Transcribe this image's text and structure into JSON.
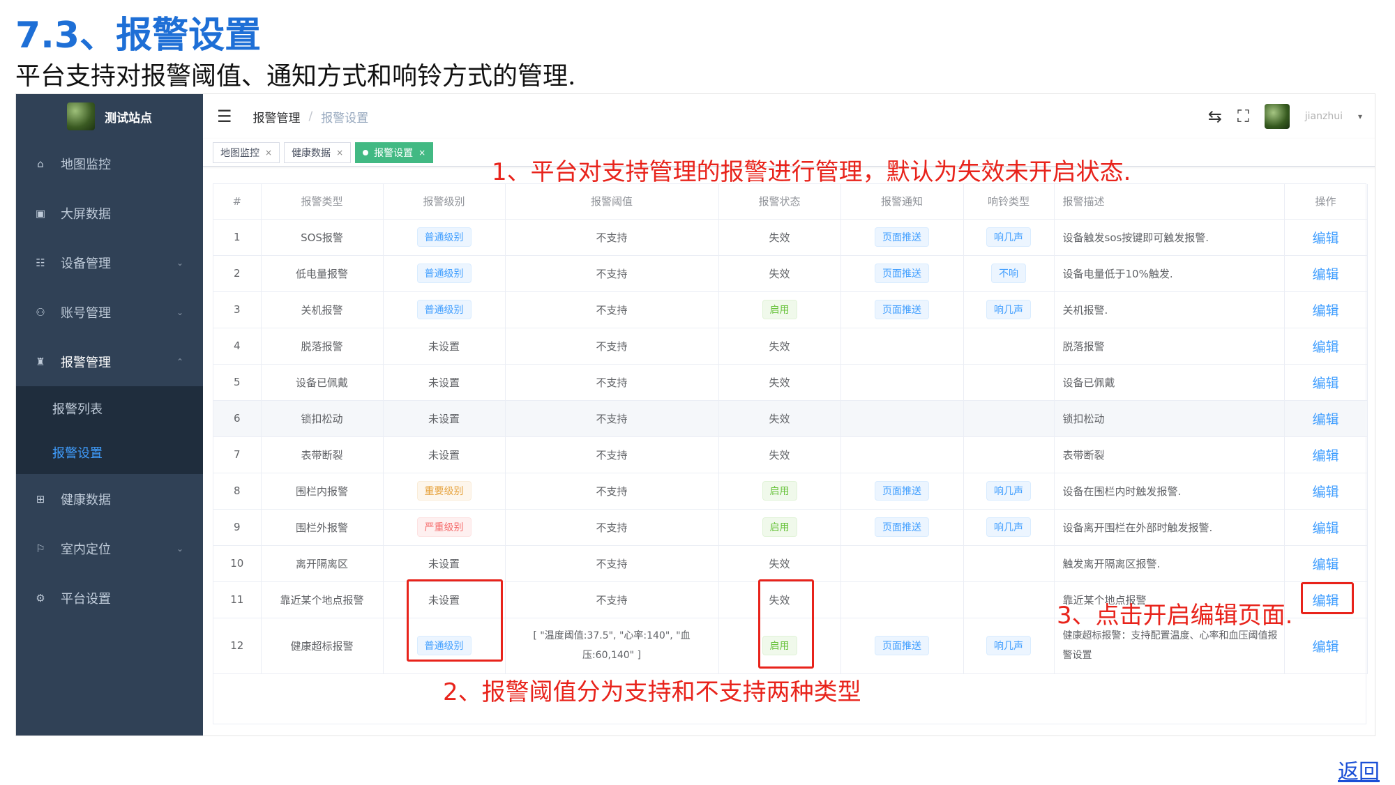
{
  "doc": {
    "title": "7.3、报警设置",
    "description": "平台支持对报警阈值、通知方式和响铃方式的管理.",
    "back_link": "返回"
  },
  "sidebar": {
    "site_name": "测试站点",
    "items": [
      {
        "label": "地图监控",
        "icon": "home-icon",
        "glyph": "⌂",
        "has_children": false
      },
      {
        "label": "大屏数据",
        "icon": "chart-icon",
        "glyph": "▣",
        "has_children": false
      },
      {
        "label": "设备管理",
        "icon": "server-icon",
        "glyph": "☷",
        "has_children": true
      },
      {
        "label": "账号管理",
        "icon": "org-icon",
        "glyph": "⚇",
        "has_children": true
      },
      {
        "label": "报警管理",
        "icon": "alarm-icon",
        "glyph": "♜",
        "has_children": true,
        "expanded": true
      },
      {
        "label": "健康数据",
        "icon": "medkit-icon",
        "glyph": "⊞",
        "has_children": false
      },
      {
        "label": "室内定位",
        "icon": "map-icon",
        "glyph": "⚐",
        "has_children": true
      },
      {
        "label": "平台设置",
        "icon": "gear-icon",
        "glyph": "⚙",
        "has_children": false
      }
    ],
    "alarm_submenu": [
      {
        "label": "报警列表",
        "active": false
      },
      {
        "label": "报警设置",
        "active": true
      }
    ]
  },
  "navbar": {
    "breadcrumb": [
      "报警管理",
      "报警设置"
    ],
    "user_name": "jianzhui"
  },
  "tags": [
    {
      "label": "地图监控",
      "active": false
    },
    {
      "label": "健康数据",
      "active": false
    },
    {
      "label": "报警设置",
      "active": true
    }
  ],
  "table": {
    "columns": [
      "#",
      "报警类型",
      "报警级别",
      "报警阈值",
      "报警状态",
      "报警通知",
      "响铃类型",
      "报警描述",
      "操作"
    ],
    "rows": [
      {
        "no": "1",
        "type": "SOS报警",
        "level": "普通级别",
        "level_style": "blue",
        "threshold": "不支持",
        "status": "失效",
        "status_style": "plain",
        "notify": "页面推送",
        "ring": "响几声",
        "desc": "设备触发sos按键即可触发报警.",
        "action": "编辑"
      },
      {
        "no": "2",
        "type": "低电量报警",
        "level": "普通级别",
        "level_style": "blue",
        "threshold": "不支持",
        "status": "失效",
        "status_style": "plain",
        "notify": "页面推送",
        "ring": "不响",
        "desc": "设备电量低于10%触发.",
        "action": "编辑"
      },
      {
        "no": "3",
        "type": "关机报警",
        "level": "普通级别",
        "level_style": "blue",
        "threshold": "不支持",
        "status": "启用",
        "status_style": "green",
        "notify": "页面推送",
        "ring": "响几声",
        "desc": "关机报警.",
        "action": "编辑"
      },
      {
        "no": "4",
        "type": "脱落报警",
        "level": "未设置",
        "level_style": "plain",
        "threshold": "不支持",
        "status": "失效",
        "status_style": "plain",
        "notify": "",
        "ring": "",
        "desc": "脱落报警",
        "action": "编辑"
      },
      {
        "no": "5",
        "type": "设备已佩戴",
        "level": "未设置",
        "level_style": "plain",
        "threshold": "不支持",
        "status": "失效",
        "status_style": "plain",
        "notify": "",
        "ring": "",
        "desc": "设备已佩戴",
        "action": "编辑"
      },
      {
        "no": "6",
        "type": "锁扣松动",
        "level": "未设置",
        "level_style": "plain",
        "threshold": "不支持",
        "status": "失效",
        "status_style": "plain",
        "notify": "",
        "ring": "",
        "desc": "锁扣松动",
        "action": "编辑"
      },
      {
        "no": "7",
        "type": "表带断裂",
        "level": "未设置",
        "level_style": "plain",
        "threshold": "不支持",
        "status": "失效",
        "status_style": "plain",
        "notify": "",
        "ring": "",
        "desc": "表带断裂",
        "action": "编辑"
      },
      {
        "no": "8",
        "type": "围栏内报警",
        "level": "重要级别",
        "level_style": "orange",
        "threshold": "不支持",
        "status": "启用",
        "status_style": "green",
        "notify": "页面推送",
        "ring": "响几声",
        "desc": "设备在围栏内时触发报警.",
        "action": "编辑"
      },
      {
        "no": "9",
        "type": "围栏外报警",
        "level": "严重级别",
        "level_style": "red",
        "threshold": "不支持",
        "status": "启用",
        "status_style": "green",
        "notify": "页面推送",
        "ring": "响几声",
        "desc": "设备离开围栏在外部时触发报警.",
        "action": "编辑"
      },
      {
        "no": "10",
        "type": "离开隔离区",
        "level": "未设置",
        "level_style": "plain",
        "threshold": "不支持",
        "status": "失效",
        "status_style": "plain",
        "notify": "",
        "ring": "",
        "desc": "触发离开隔离区报警.",
        "action": "编辑"
      },
      {
        "no": "11",
        "type": "靠近某个地点报警",
        "level": "未设置",
        "level_style": "plain",
        "threshold": "不支持",
        "status": "失效",
        "status_style": "plain",
        "notify": "",
        "ring": "",
        "desc": "靠近某个地点报警",
        "action": "编辑"
      },
      {
        "no": "12",
        "type": "健康超标报警",
        "level": "普通级别",
        "level_style": "blue",
        "threshold": "[ \"温度阈值:37.5\", \"心率:140\", \"血压:60,140\" ]",
        "status": "启用",
        "status_style": "green",
        "notify": "页面推送",
        "ring": "响几声",
        "desc": "健康超标报警：支持配置温度、心率和血压阈值报警设置",
        "action": "编辑"
      }
    ]
  },
  "annotations": {
    "note1": "1、平台对支持管理的报警进行管理，默认为失效未开启状态.",
    "note2": "2、报警阈值分为支持和不支持两种类型",
    "note3": "3、点击开启编辑页面.",
    "color": "#e8231b"
  },
  "colors": {
    "sidebar_bg": "#304156",
    "submenu_bg": "#1f2d3d",
    "accent": "#409eff",
    "tag_active": "#42b983",
    "title_blue": "#1e6fd6"
  }
}
